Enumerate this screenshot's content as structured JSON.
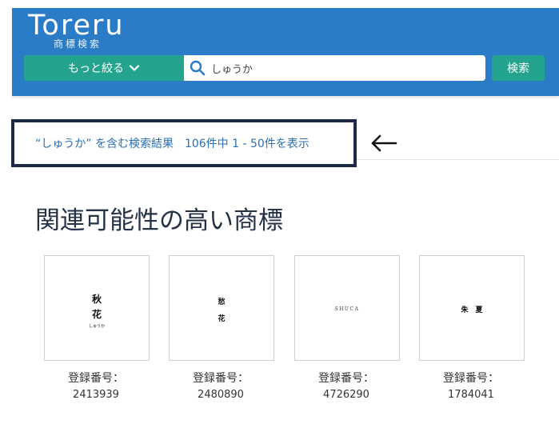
{
  "header": {
    "logo_text": "Toreru",
    "logo_subtitle": "商標検索",
    "narrow_label": "もっと絞る",
    "search_value": "しゅうか",
    "search_button": "検索",
    "colors": {
      "header_bg": "#2b7cc6",
      "button_bg": "#24a48e"
    },
    "icons": {
      "search": "search-icon",
      "chevron": "chevron-down-icon"
    }
  },
  "results": {
    "summary": "“しゅうか” を含む検索結果　106件中 1 - 50件を表示"
  },
  "section": {
    "title": "関連可能性の高い商標"
  },
  "trademarks": [
    {
      "image_lines": [
        "秋",
        "花",
        "しゅうか"
      ],
      "reg_label": "登録番号：",
      "reg_number": "2413939"
    },
    {
      "image_lines": [
        "愁",
        "花"
      ],
      "reg_label": "登録番号：",
      "reg_number": "2480890"
    },
    {
      "image_lines": [
        "SHUCA"
      ],
      "reg_label": "登録番号：",
      "reg_number": "4726290"
    },
    {
      "image_lines": [
        "朱　夏"
      ],
      "reg_label": "登録番号：",
      "reg_number": "1784041"
    }
  ]
}
